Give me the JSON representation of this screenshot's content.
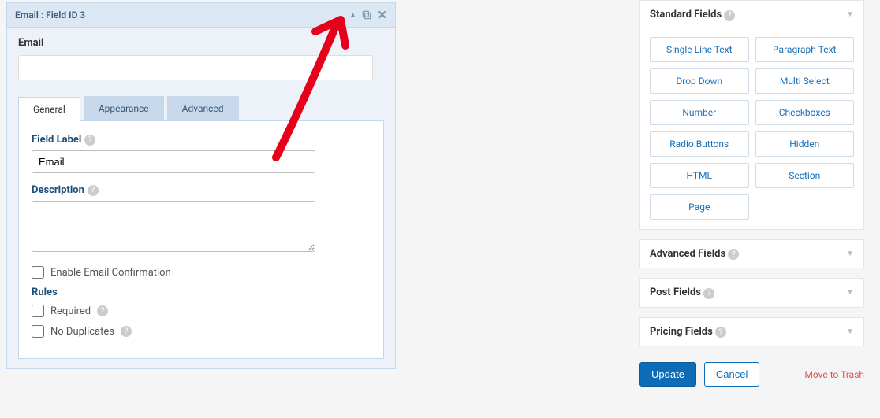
{
  "field": {
    "header_title": "Email : Field ID 3",
    "preview_label": "Email",
    "tabs": {
      "general": "General",
      "appearance": "Appearance",
      "advanced": "Advanced"
    },
    "labels": {
      "field_label": "Field Label",
      "description": "Description",
      "enable_confirm": "Enable Email Confirmation",
      "rules": "Rules",
      "required": "Required",
      "no_duplicates": "No Duplicates"
    },
    "values": {
      "field_label_value": "Email",
      "description_value": ""
    }
  },
  "sidebar": {
    "sections": {
      "standard": "Standard Fields",
      "advanced": "Advanced Fields",
      "post": "Post Fields",
      "pricing": "Pricing Fields"
    },
    "standard_fields": [
      "Single Line Text",
      "Paragraph Text",
      "Drop Down",
      "Multi Select",
      "Number",
      "Checkboxes",
      "Radio Buttons",
      "Hidden",
      "HTML",
      "Section",
      "Page"
    ],
    "actions": {
      "update": "Update",
      "cancel": "Cancel",
      "trash": "Move to Trash"
    }
  }
}
